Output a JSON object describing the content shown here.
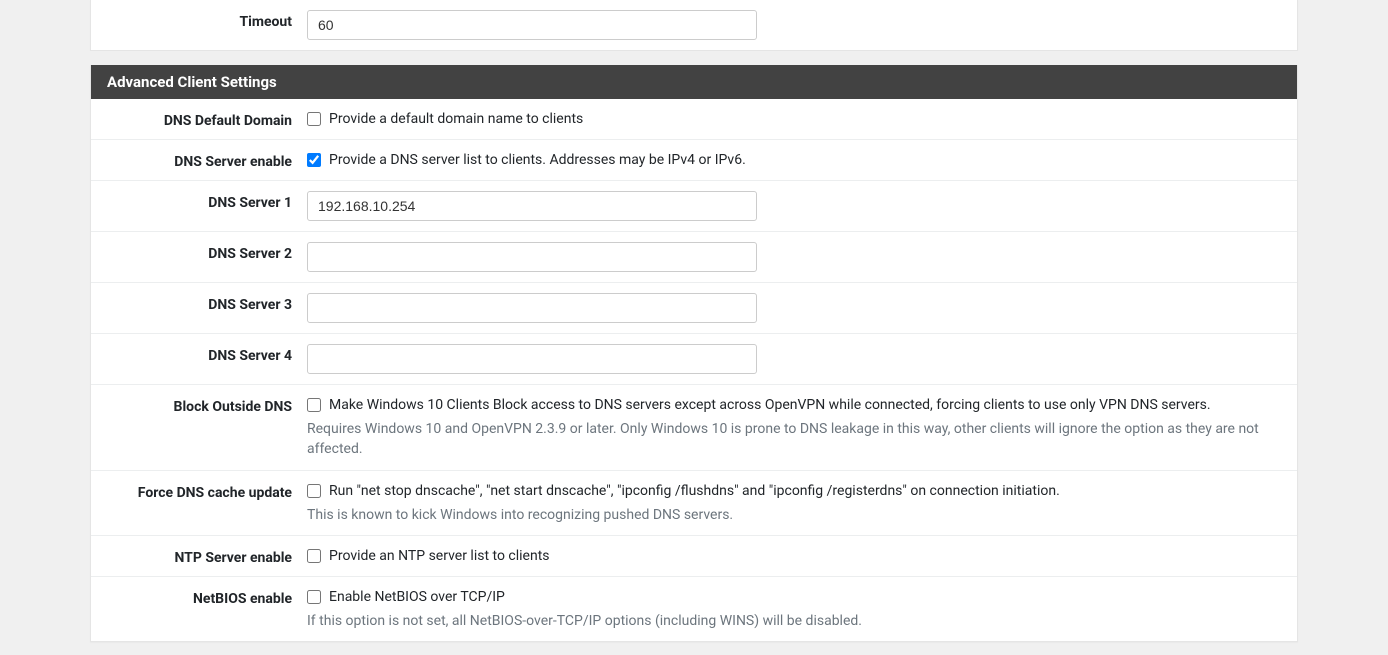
{
  "timeout": {
    "label": "Timeout",
    "value": "60"
  },
  "advanced": {
    "header": "Advanced Client Settings",
    "dns_default_domain": {
      "label": "DNS Default Domain",
      "checked": false,
      "text": "Provide a default domain name to clients"
    },
    "dns_server_enable": {
      "label": "DNS Server enable",
      "checked": true,
      "text": "Provide a DNS server list to clients. Addresses may be IPv4 or IPv6."
    },
    "dns_server_1": {
      "label": "DNS Server 1",
      "value": "192.168.10.254"
    },
    "dns_server_2": {
      "label": "DNS Server 2",
      "value": ""
    },
    "dns_server_3": {
      "label": "DNS Server 3",
      "value": ""
    },
    "dns_server_4": {
      "label": "DNS Server 4",
      "value": ""
    },
    "block_outside_dns": {
      "label": "Block Outside DNS",
      "checked": false,
      "text": "Make Windows 10 Clients Block access to DNS servers except across OpenVPN while connected, forcing clients to use only VPN DNS servers.",
      "help": "Requires Windows 10 and OpenVPN 2.3.9 or later. Only Windows 10 is prone to DNS leakage in this way, other clients will ignore the option as they are not affected."
    },
    "force_dns_cache_update": {
      "label": "Force DNS cache update",
      "checked": false,
      "text": "Run \"net stop dnscache\", \"net start dnscache\", \"ipconfig /flushdns\" and \"ipconfig /registerdns\" on connection initiation.",
      "help": "This is known to kick Windows into recognizing pushed DNS servers."
    },
    "ntp_server_enable": {
      "label": "NTP Server enable",
      "checked": false,
      "text": "Provide an NTP server list to clients"
    },
    "netbios_enable": {
      "label": "NetBIOS enable",
      "checked": false,
      "text": "Enable NetBIOS over TCP/IP",
      "help": "If this option is not set, all NetBIOS-over-TCP/IP options (including WINS) will be disabled."
    }
  }
}
